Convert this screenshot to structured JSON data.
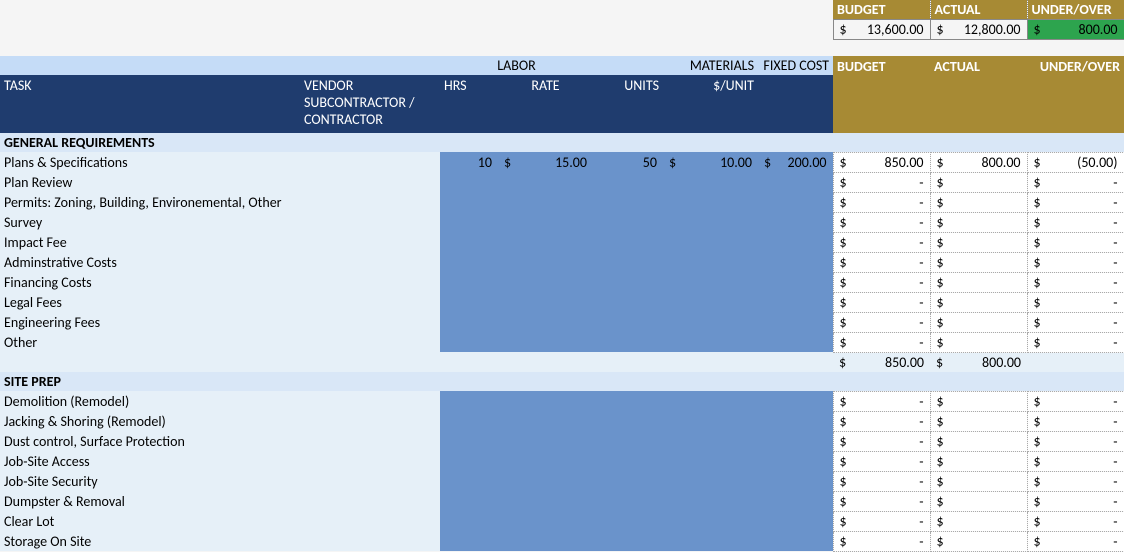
{
  "summary": {
    "budget_label": "BUDGET",
    "actual_label": "ACTUAL",
    "diff_label": "UNDER/OVER",
    "budget": "13,600.00",
    "actual": "12,800.00",
    "diff": "800.00"
  },
  "band": {
    "labor": "LABOR",
    "materials": "MATERIALS",
    "fixed": "FIXED COST"
  },
  "head": {
    "task": "TASK",
    "vendor": "VENDOR SUBCONTRACTOR / CONTRACTOR",
    "hrs": "HRS",
    "rate": "RATE",
    "units": "UNITS",
    "per_unit": "$/UNIT",
    "budget": "BUDGET",
    "actual": "ACTUAL",
    "diff": "UNDER/OVER"
  },
  "sections": [
    {
      "title": "GENERAL REQUIREMENTS",
      "rows": [
        {
          "task": "Plans & Specifications",
          "hrs": "10",
          "rate": "15.00",
          "units": "50",
          "per_unit": "10.00",
          "fixed": "200.00",
          "budget": "850.00",
          "actual": "800.00",
          "diff": "(50.00)"
        },
        {
          "task": "Plan Review",
          "budget": "-",
          "actual": "",
          "diff": "-"
        },
        {
          "task": "Permits: Zoning, Building, Environemental, Other",
          "budget": "-",
          "actual": "",
          "diff": "-"
        },
        {
          "task": "Survey",
          "budget": "-",
          "actual": "",
          "diff": "-"
        },
        {
          "task": "Impact Fee",
          "budget": "-",
          "actual": "",
          "diff": "-"
        },
        {
          "task": "Adminstrative Costs",
          "budget": "-",
          "actual": "",
          "diff": "-"
        },
        {
          "task": "Financing Costs",
          "budget": "-",
          "actual": "",
          "diff": "-"
        },
        {
          "task": "Legal Fees",
          "budget": "-",
          "actual": "",
          "diff": "-"
        },
        {
          "task": "Engineering Fees",
          "budget": "-",
          "actual": "",
          "diff": "-"
        },
        {
          "task": "Other",
          "budget": "-",
          "actual": "",
          "diff": "-"
        }
      ],
      "subtotal": {
        "budget": "850.00",
        "actual": "800.00",
        "diff": ""
      }
    },
    {
      "title": "SITE PREP",
      "rows": [
        {
          "task": "Demolition (Remodel)",
          "budget": "-",
          "actual": "",
          "diff": "-"
        },
        {
          "task": "Jacking & Shoring (Remodel)",
          "budget": "-",
          "actual": "",
          "diff": "-"
        },
        {
          "task": "Dust control, Surface Protection",
          "budget": "-",
          "actual": "",
          "diff": "-"
        },
        {
          "task": "Job-Site Access",
          "budget": "-",
          "actual": "",
          "diff": "-"
        },
        {
          "task": "Job-Site Security",
          "budget": "-",
          "actual": "",
          "diff": "-"
        },
        {
          "task": "Dumpster & Removal",
          "budget": "-",
          "actual": "",
          "diff": "-"
        },
        {
          "task": "Clear Lot",
          "budget": "-",
          "actual": "",
          "diff": "-"
        },
        {
          "task": "Storage On Site",
          "budget": "-",
          "actual": "",
          "diff": "-"
        }
      ]
    }
  ]
}
